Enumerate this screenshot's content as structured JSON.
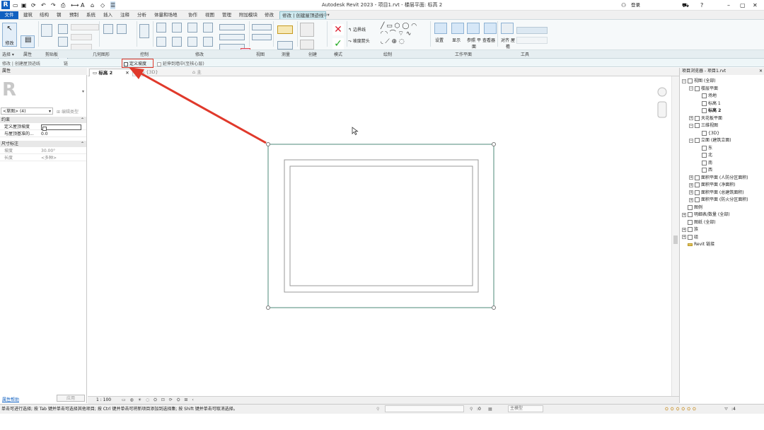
{
  "window": {
    "title": "Autodesk Revit 2023 - 项目1.rvt - 楼层平面: 标高 2",
    "user": "登录"
  },
  "menu": {
    "tabs": [
      "文件",
      "建筑",
      "结构",
      "钢",
      "预制",
      "系统",
      "插入",
      "注释",
      "分析",
      "体量和场地",
      "协作",
      "视图",
      "管理",
      "附加模块",
      "修改",
      "修改 | 创建屋顶迹线"
    ]
  },
  "ribbon": {
    "groups": [
      "选择 ▾",
      "属性",
      "剪贴板",
      "几何图形",
      "控制",
      "修改",
      "视图",
      "测量",
      "创建",
      "模式",
      "绘制",
      "工作平面",
      "工具"
    ],
    "modify_label": "修改",
    "boundary_line": "边界线",
    "slope_arrow": "坡度箭头",
    "set_label": "设置",
    "show_label": "显示",
    "ref_plane": "参照 平面",
    "viewer": "查看器",
    "align": "对齐 屋檐"
  },
  "options": {
    "modify": "修改 | 创建屋顶迹线",
    "chain": "链",
    "define_slope": "定义坡度",
    "extend_to_wall": "延伸到墙中(至核心层)"
  },
  "properties": {
    "header": "属性",
    "type_selector": "<草图> (4)",
    "edit_type": "编辑类型",
    "section_constraints": "约束",
    "define_slope_label": "定义屋顶坡度",
    "offset_label": "与屋顶基准的...",
    "offset_value": "0.0",
    "section_dims": "尺寸标注",
    "slope_label": "坡度",
    "slope_value": "30.00°",
    "length_label": "长度",
    "length_value": "<多种>",
    "help_link": "属性帮助",
    "apply_button": "应用"
  },
  "view_tabs": [
    {
      "label": "标高 2"
    },
    {
      "label": "{3D}"
    },
    {
      "label": "主"
    }
  ],
  "browser": {
    "title": "项目浏览器 - 项目1.rvt",
    "nodes": [
      {
        "text": "视图 (全部)",
        "level": 0
      },
      {
        "text": "楼层平面",
        "level": 1
      },
      {
        "text": "场地",
        "level": 2
      },
      {
        "text": "标高 1",
        "level": 2
      },
      {
        "text": "标高 2",
        "level": 2
      },
      {
        "text": "天花板平面",
        "level": 1
      },
      {
        "text": "三维视图",
        "level": 1
      },
      {
        "text": "{3D}",
        "level": 2
      },
      {
        "text": "立面 (建筑立面)",
        "level": 1
      },
      {
        "text": "东",
        "level": 2
      },
      {
        "text": "北",
        "level": 2
      },
      {
        "text": "南",
        "level": 2
      },
      {
        "text": "西",
        "level": 2
      },
      {
        "text": "面积平面 (人防分区面积)",
        "level": 1
      },
      {
        "text": "面积平面 (净面积)",
        "level": 1
      },
      {
        "text": "面积平面 (总建筑面积)",
        "level": 1
      },
      {
        "text": "面积平面 (防火分区面积)",
        "level": 1
      },
      {
        "text": "图例",
        "level": 0
      },
      {
        "text": "明细表/数量 (全部)",
        "level": 0
      },
      {
        "text": "图纸 (全部)",
        "level": 0
      },
      {
        "text": "族",
        "level": 0
      },
      {
        "text": "组",
        "level": 0
      },
      {
        "text": "Revit 链接",
        "level": 0
      }
    ]
  },
  "viewcontrol": {
    "scale": "1 : 100"
  },
  "status": {
    "text": "单击可进行选择; 按 Tab 键并单击可选择其他项目; 按 Ctrl 键并单击可将新项目添加到选择集; 按 Shift 键并单击可取消选择。",
    "zero": ":0",
    "model_label": "主模型",
    "filter_count": ":4"
  },
  "colors": {
    "accent": "#1060c0",
    "annotation": "#e0392b"
  }
}
